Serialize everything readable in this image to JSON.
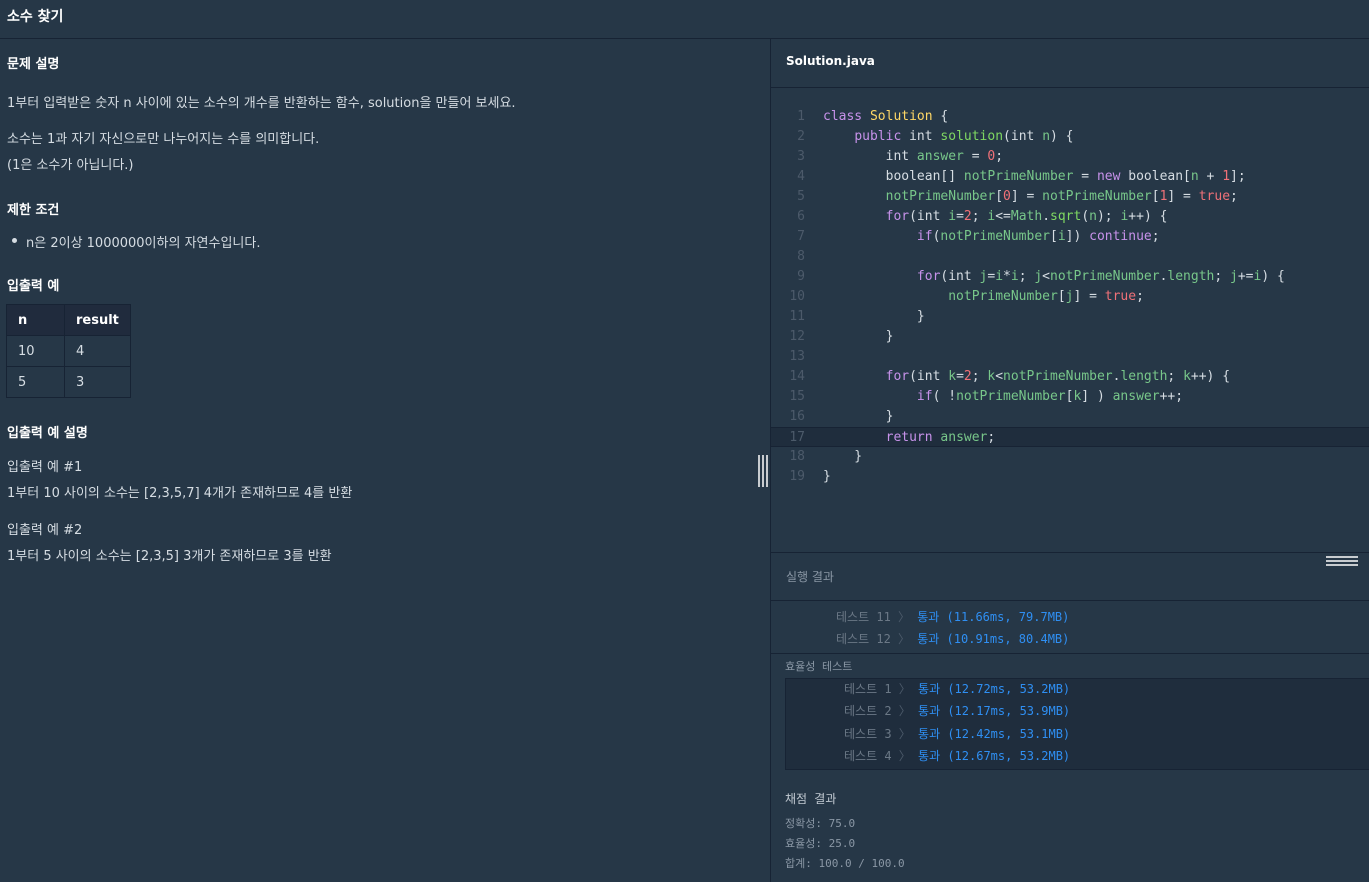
{
  "header": {
    "title": "소수 찾기"
  },
  "problem": {
    "description_heading": "문제 설명",
    "description": "1부터 입력받은 숫자 n 사이에 있는 소수의 개수를 반환하는 함수, solution을 만들어 보세요.",
    "note1": "소수는 1과 자기 자신으로만 나누어지는 수를 의미합니다.",
    "note2": "(1은 소수가 아닙니다.)",
    "constraints_heading": "제한 조건",
    "constraint1": "n은 2이상 1000000이하의 자연수입니다.",
    "examples_heading": "입출력 예",
    "table": {
      "headers": [
        "n",
        "result"
      ],
      "rows": [
        [
          "10",
          "4"
        ],
        [
          "5",
          "3"
        ]
      ]
    },
    "examples_explain_heading": "입출력 예 설명",
    "ex1_title": "입출력 예 #1",
    "ex1_text": "1부터 10 사이의 소수는 [2,3,5,7] 4개가 존재하므로 4를 반환",
    "ex2_title": "입출력 예 #2",
    "ex2_text": "1부터 5 사이의 소수는 [2,3,5] 3개가 존재하므로 3를 반환"
  },
  "editor": {
    "filename": "Solution.java",
    "line_numbers": [
      "1",
      "2",
      "3",
      "4",
      "5",
      "6",
      "7",
      "8",
      "9",
      "10",
      "11",
      "12",
      "13",
      "14",
      "15",
      "16",
      "17",
      "18",
      "19"
    ],
    "active_line": 17
  },
  "results": {
    "label": "실행 결과",
    "accuracy_tests": [
      {
        "name": "테스트 11",
        "result": "통과 (11.66ms, 79.7MB)"
      },
      {
        "name": "테스트 12",
        "result": "통과 (10.91ms, 80.4MB)"
      }
    ],
    "efficiency_label": "효율성  테스트",
    "efficiency_tests": [
      {
        "name": "테스트 1",
        "result": "통과 (12.72ms, 53.2MB)"
      },
      {
        "name": "테스트 2",
        "result": "통과 (12.17ms, 53.9MB)"
      },
      {
        "name": "테스트 3",
        "result": "통과 (12.42ms, 53.1MB)"
      },
      {
        "name": "테스트 4",
        "result": "통과 (12.67ms, 53.2MB)"
      }
    ],
    "score_title": "채점 결과",
    "accuracy_score": "정확성: 75.0",
    "efficiency_score": "효율성: 25.0",
    "total_score": "합계: 100.0 / 100.0"
  },
  "colors": {
    "background": "#263747",
    "pass": "#2f8ff3",
    "keyword": "#c792ea",
    "class_name": "#ffd866"
  }
}
